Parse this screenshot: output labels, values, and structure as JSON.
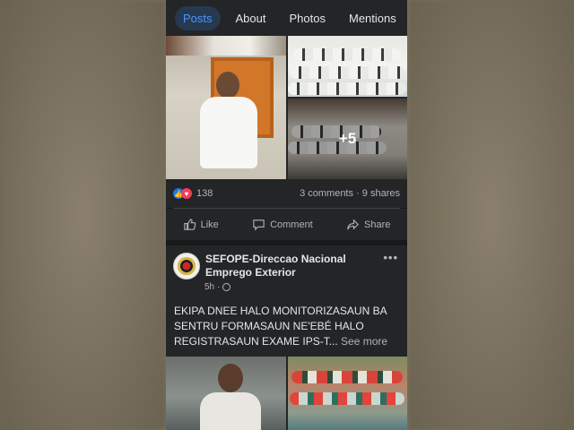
{
  "tabs": [
    {
      "label": "Posts",
      "active": true
    },
    {
      "label": "About",
      "active": false
    },
    {
      "label": "Photos",
      "active": false
    },
    {
      "label": "Mentions",
      "active": false
    }
  ],
  "post1": {
    "more_photos": "+5",
    "reaction_count": "138",
    "comments": "3 comments",
    "shares": "9 shares",
    "actions": {
      "like": "Like",
      "comment": "Comment",
      "share": "Share"
    }
  },
  "post2": {
    "page_name": "SEFOPE-Direccao Nacional Emprego Exterior",
    "time": "5h",
    "more_label": "•••",
    "text": "EKIPA DNEE HALO MONITORIZASAUN BA SENTRU FORMASAUN NE'EBÉ HALO REGISTRASAUN EXAME IPS-T...",
    "see_more": "See more"
  },
  "colors": {
    "background": "#18191a",
    "card": "#242526",
    "accent": "#4599ff",
    "like_blue": "#1877f2",
    "love_red": "#f33e58"
  },
  "icons": [
    "like-reaction-icon",
    "love-reaction-icon",
    "thumbs-up-icon",
    "comment-icon",
    "share-icon",
    "globe-icon",
    "more-icon"
  ]
}
